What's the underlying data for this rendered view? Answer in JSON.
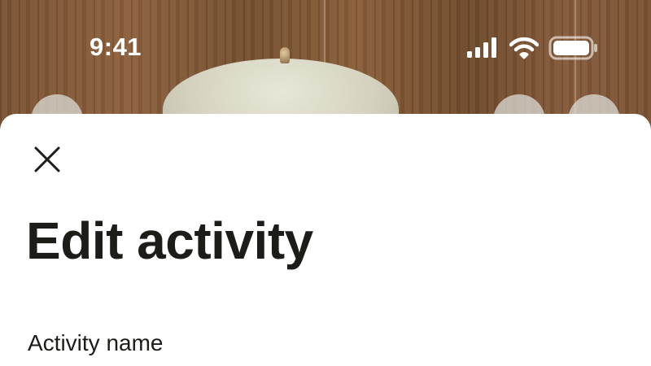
{
  "status_bar": {
    "time": "9:41",
    "icons": [
      "signal-icon",
      "wifi-icon",
      "battery-icon"
    ]
  },
  "background": {
    "description_icon": "photo-background"
  },
  "sheet": {
    "close_icon": "close-icon",
    "title": "Edit activity",
    "fields": [
      {
        "label": "Activity name"
      }
    ]
  },
  "colors": {
    "text_primary": "#1c1d18",
    "sheet_background": "#ffffff",
    "status_text": "#ffffff"
  }
}
